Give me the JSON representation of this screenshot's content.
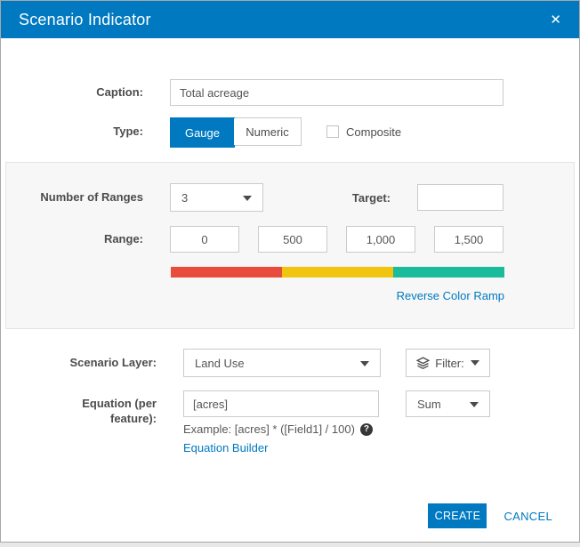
{
  "dialog": {
    "title": "Scenario Indicator",
    "close_icon": "✕"
  },
  "form": {
    "caption": {
      "label": "Caption:",
      "value": "Total acreage"
    },
    "type": {
      "label": "Type:",
      "option_gauge": "Gauge",
      "option_numeric": "Numeric",
      "selected": "Gauge",
      "composite_label": "Composite",
      "composite_checked": false
    },
    "ranges": {
      "number_label": "Number of Ranges",
      "number_value": "3",
      "target_label": "Target:",
      "target_value": "",
      "range_label": "Range:",
      "range_values": [
        "0",
        "500",
        "1,000",
        "1,500"
      ],
      "ramp_colors": [
        "#e74c3c",
        "#f1c40f",
        "#1abc9c"
      ],
      "reverse_link": "Reverse Color Ramp"
    },
    "layer": {
      "label": "Scenario Layer:",
      "value": "Land Use",
      "filter_label": "Filter:"
    },
    "equation": {
      "label_line1": "Equation (per",
      "label_line2": "feature):",
      "value": "[acres]",
      "example": "Example: [acres] * ([Field1] / 100)",
      "help_icon": "?",
      "builder_link": "Equation Builder",
      "aggregation_value": "Sum"
    }
  },
  "footer": {
    "create_label": "CREATE",
    "cancel_label": "CANCEL"
  },
  "colors": {
    "accent": "#0079c1",
    "ramp": [
      "#e74c3c",
      "#f1c40f",
      "#1abc9c"
    ]
  }
}
